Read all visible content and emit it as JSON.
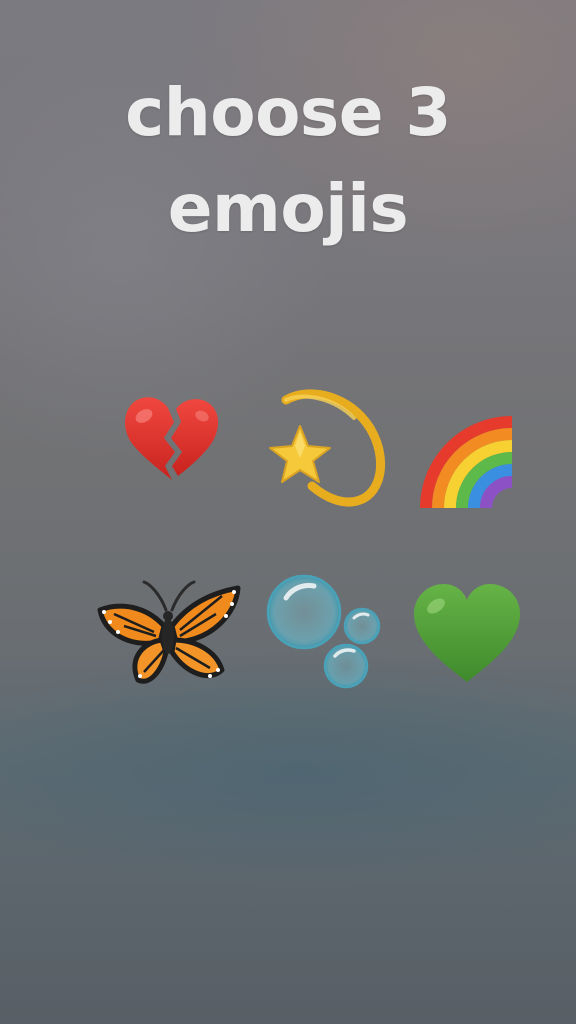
{
  "title": {
    "line1": "choose 3",
    "line2": "emojis"
  },
  "emojis": [
    {
      "name": "broken-heart",
      "row": 1,
      "col": 1
    },
    {
      "name": "dizzy-star",
      "row": 1,
      "col": 2
    },
    {
      "name": "rainbow",
      "row": 1,
      "col": 3
    },
    {
      "name": "butterfly",
      "row": 2,
      "col": 1
    },
    {
      "name": "bubbles",
      "row": 2,
      "col": 2
    },
    {
      "name": "green-heart",
      "row": 2,
      "col": 3
    }
  ],
  "colors": {
    "title": "#ececec",
    "background": "#717274",
    "heart_red": "#e0332e",
    "star_yellow": "#f2c531",
    "heart_green": "#56a33c",
    "butterfly_orange": "#f08a1c",
    "bubble_blue": "#72c6d8"
  }
}
